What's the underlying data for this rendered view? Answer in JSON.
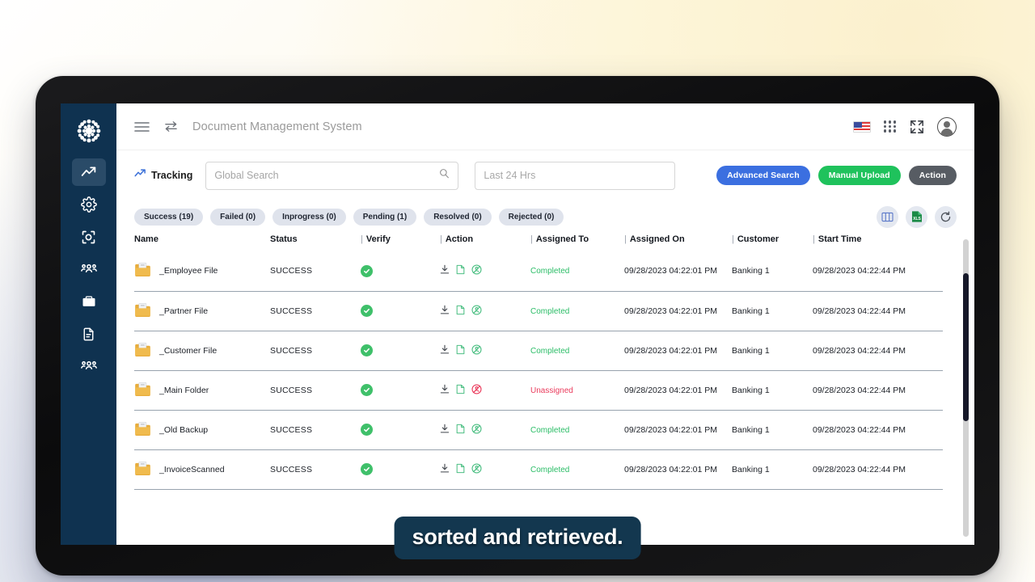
{
  "app": {
    "title": "Document Management System"
  },
  "sidebar": {
    "logo_icon": "gear-burst-logo",
    "items": [
      {
        "name": "tracking",
        "icon": "trend-up-icon",
        "active": true
      },
      {
        "name": "settings",
        "icon": "gear-icon",
        "active": false
      },
      {
        "name": "scan",
        "icon": "scan-frame-icon",
        "active": false
      },
      {
        "name": "teams",
        "icon": "people-icon",
        "active": false
      },
      {
        "name": "briefcase",
        "icon": "briefcase-icon",
        "active": false
      },
      {
        "name": "documents",
        "icon": "document-icon",
        "active": false
      },
      {
        "name": "users",
        "icon": "people-icon",
        "active": false
      }
    ]
  },
  "topbar": {
    "menu_icon": "hamburger-icon",
    "swap_icon": "swap-arrows-icon",
    "flag_icon": "us-flag-icon",
    "apps_icon": "grid-dots-icon",
    "fullscreen_icon": "expand-icon",
    "avatar_icon": "user-avatar-icon"
  },
  "toolbar": {
    "tracking_label": "Tracking",
    "tracking_icon": "trend-up-icon",
    "search": {
      "placeholder": "Global Search",
      "value": "",
      "icon": "search-icon"
    },
    "date_filter": {
      "placeholder": "Last 24 Hrs",
      "value": ""
    },
    "advanced_search_label": "Advanced Search",
    "manual_upload_label": "Manual Upload",
    "action_label": "Action",
    "colors": {
      "advanced_search": "#3b6fe0",
      "manual_upload": "#1fc25c",
      "action": "#575c63"
    }
  },
  "filters": {
    "chips": [
      {
        "label": "Success (19)"
      },
      {
        "label": "Failed (0)"
      },
      {
        "label": "Inprogress (0)"
      },
      {
        "label": "Pending (1)"
      },
      {
        "label": "Resolved (0)"
      },
      {
        "label": "Rejected (0)"
      }
    ],
    "tools": [
      {
        "name": "columns-icon"
      },
      {
        "name": "xls-export-icon"
      },
      {
        "name": "refresh-icon"
      }
    ]
  },
  "table": {
    "columns": [
      {
        "key": "name",
        "label": "Name",
        "divider": false
      },
      {
        "key": "status",
        "label": "Status",
        "divider": false
      },
      {
        "key": "verify",
        "label": "Verify",
        "divider": true
      },
      {
        "key": "action",
        "label": "Action",
        "divider": true
      },
      {
        "key": "assigned_to",
        "label": "Assigned To",
        "divider": true
      },
      {
        "key": "assigned_on",
        "label": "Assigned On",
        "divider": true
      },
      {
        "key": "customer",
        "label": "Customer",
        "divider": true
      },
      {
        "key": "start_time",
        "label": "Start Time",
        "divider": true
      }
    ],
    "rows": [
      {
        "name": "_Employee File",
        "status": "SUCCESS",
        "verify": "verified",
        "assigned_to": "Completed",
        "assigned_to_state": "ok",
        "assigned_on": "09/28/2023 04:22:01 PM",
        "customer": "Banking 1",
        "start_time": "09/28/2023 04:22:44 PM",
        "action_state": "ok"
      },
      {
        "name": "_Partner File",
        "status": "SUCCESS",
        "verify": "verified",
        "assigned_to": "Completed",
        "assigned_to_state": "ok",
        "assigned_on": "09/28/2023 04:22:01 PM",
        "customer": "Banking 1",
        "start_time": "09/28/2023 04:22:44 PM",
        "action_state": "ok"
      },
      {
        "name": "_Customer File",
        "status": "SUCCESS",
        "verify": "verified",
        "assigned_to": "Completed",
        "assigned_to_state": "ok",
        "assigned_on": "09/28/2023 04:22:01 PM",
        "customer": "Banking 1",
        "start_time": "09/28/2023 04:22:44 PM",
        "action_state": "ok"
      },
      {
        "name": "_Main Folder",
        "status": "SUCCESS",
        "verify": "verified",
        "assigned_to": "Unassigned",
        "assigned_to_state": "bad",
        "assigned_on": "09/28/2023 04:22:01 PM",
        "customer": "Banking 1",
        "start_time": "09/28/2023 04:22:44 PM",
        "action_state": "bad"
      },
      {
        "name": "_Old Backup",
        "status": "SUCCESS",
        "verify": "verified",
        "assigned_to": "Completed",
        "assigned_to_state": "ok",
        "assigned_on": "09/28/2023 04:22:01 PM",
        "customer": "Banking 1",
        "start_time": "09/28/2023 04:22:44 PM",
        "action_state": "ok"
      },
      {
        "name": "_InvoiceScanned",
        "status": "SUCCESS",
        "verify": "verified",
        "assigned_to": "Completed",
        "assigned_to_state": "ok",
        "assigned_on": "09/28/2023 04:22:01 PM",
        "customer": "Banking 1",
        "start_time": "09/28/2023 04:22:44 PM",
        "action_state": "ok"
      }
    ],
    "row_icons": {
      "folder": "folder-icon",
      "verify": "check-circle-icon",
      "download": "download-icon",
      "document": "document-outline-icon",
      "assign": "assign-user-icon"
    }
  },
  "caption": {
    "text": "sorted and retrieved."
  },
  "colors": {
    "sidebar_bg": "#0f3250",
    "sidebar_active": "#2a4b68",
    "success_green": "#2bbd67",
    "danger_red": "#ea3b5c",
    "caption_bg": "#13374f"
  }
}
